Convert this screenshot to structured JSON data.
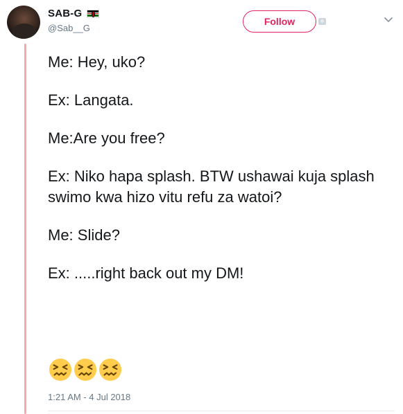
{
  "user": {
    "display_name": "SAB-G",
    "handle": "@Sab__G",
    "flag_icon": "kenya-flag-icon"
  },
  "actions": {
    "follow_label": "Follow",
    "follow_color": "#e0245e",
    "caret_icon": "chevron-down-icon"
  },
  "tweet": {
    "lines": [
      "Me: Hey, uko?",
      "Ex: Langata.",
      "Me:Are you free?",
      "Ex: Niko hapa splash. BTW ushawai kuja splash swimo kwa hizo vitu refu za watoi?",
      "Me: Slide?",
      "Ex: .....right back out my DM!"
    ],
    "emoji": [
      "confounded-face-icon",
      "confounded-face-icon",
      "confounded-face-icon"
    ],
    "timestamp": "1:21 AM - 4 Jul 2018"
  },
  "colors": {
    "thread_line": "#f4a9ad",
    "text_secondary": "#657786"
  }
}
